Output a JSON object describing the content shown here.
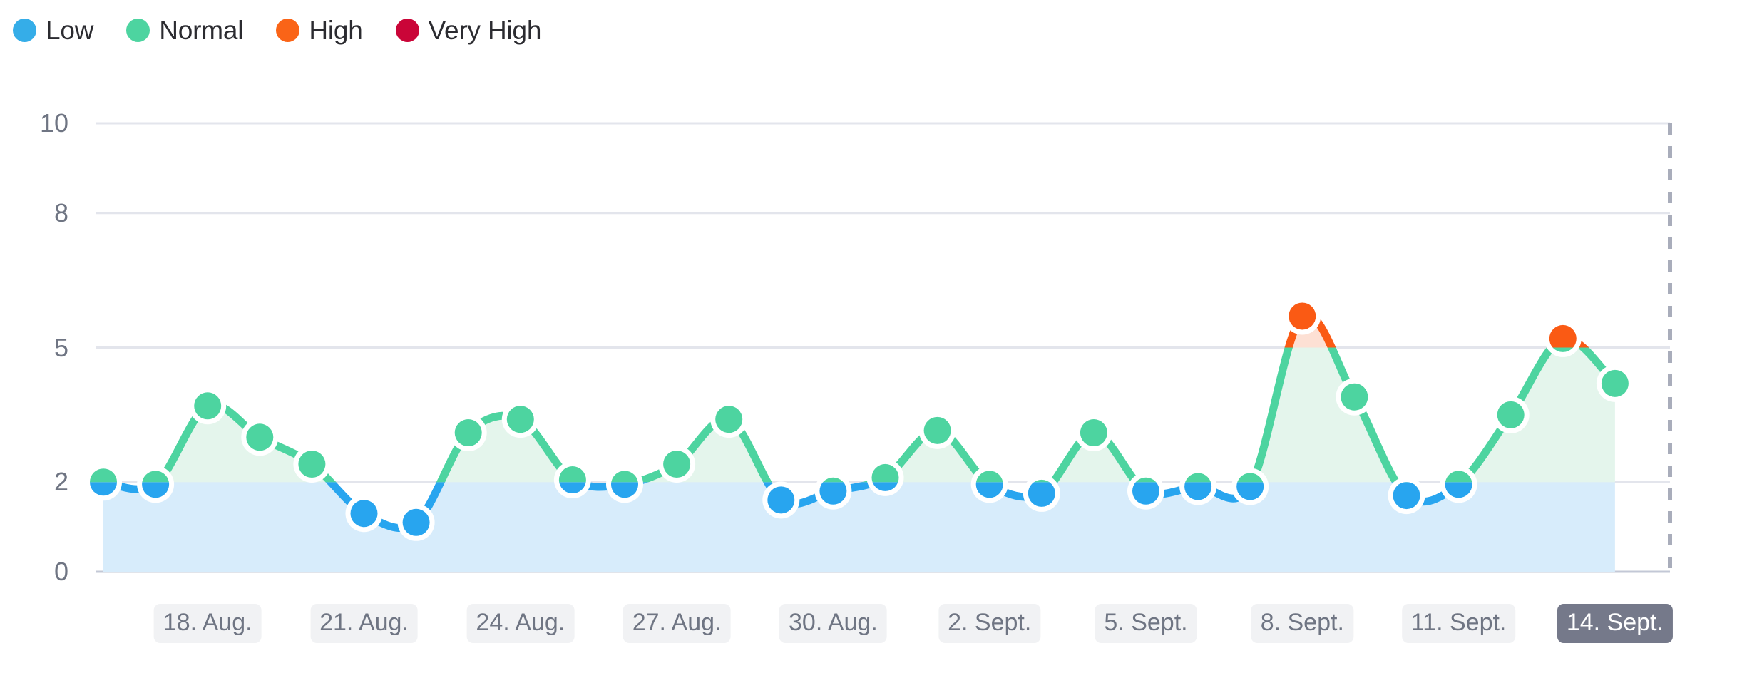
{
  "legend": {
    "items": [
      {
        "label": "Low",
        "color": "#35ade8",
        "icon": "legend-dot-icon"
      },
      {
        "label": "Normal",
        "color": "#4dd4a0",
        "icon": "legend-dot-icon"
      },
      {
        "label": "High",
        "color": "#fa6417",
        "icon": "legend-dot-icon"
      },
      {
        "label": "Very High",
        "color": "#ca0538",
        "icon": "legend-dot-icon"
      }
    ]
  },
  "chart_data": {
    "type": "line",
    "title": "",
    "subtitle": "",
    "xlabel": "",
    "ylabel": "",
    "ylim": [
      0,
      10
    ],
    "y_ticks": [
      10,
      8,
      5,
      2,
      0
    ],
    "grid": true,
    "legend_position": "top-left",
    "thresholds": {
      "low_max": 2,
      "normal_max": 5,
      "high_max": 8
    },
    "band_colors": {
      "low_fill": "#d7ecfb",
      "normal_fill": "#e4f5ec",
      "high_fill": "#fde0d4",
      "very_high_fill": "#f7d2dc",
      "low_line": "#28a5ef",
      "normal_line": "#4dd4a0",
      "high_line": "#fa5a14",
      "very_high_line": "#ca0538"
    },
    "today_marker": {
      "label": "14. Sept.",
      "style": "dashed-vertical-line",
      "color": "#a9adbb"
    },
    "x_tick_labels": [
      "18. Aug.",
      "21. Aug.",
      "24. Aug.",
      "27. Aug.",
      "30. Aug.",
      "2. Sept.",
      "5. Sept.",
      "8. Sept.",
      "11. Sept.",
      "14. Sept."
    ],
    "x_tick_indices": [
      2,
      5,
      8,
      11,
      14,
      17,
      20,
      23,
      26,
      29
    ],
    "x": [
      "16. Aug.",
      "17. Aug.",
      "18. Aug.",
      "19. Aug.",
      "20. Aug.",
      "21. Aug.",
      "22. Aug.",
      "23. Aug.",
      "24. Aug.",
      "25. Aug.",
      "26. Aug.",
      "27. Aug.",
      "28. Aug.",
      "29. Aug.",
      "30. Aug.",
      "31. Aug.",
      "1. Sept.",
      "2. Sept.",
      "3. Sept.",
      "4. Sept.",
      "5. Sept.",
      "6. Sept.",
      "7. Sept.",
      "8. Sept.",
      "9. Sept.",
      "10. Sept.",
      "11. Sept.",
      "12. Sept.",
      "13. Sept.",
      "14. Sept."
    ],
    "values": [
      2.0,
      1.95,
      3.7,
      3.0,
      2.4,
      1.3,
      1.1,
      3.1,
      3.4,
      2.05,
      1.95,
      2.4,
      3.4,
      1.6,
      1.8,
      2.1,
      3.15,
      1.95,
      1.75,
      3.1,
      1.8,
      1.9,
      1.9,
      5.7,
      3.9,
      1.7,
      1.95,
      3.5,
      5.2,
      4.2
    ],
    "point_categories": [
      "Normal",
      "Low",
      "Normal",
      "Normal",
      "Normal",
      "Low",
      "Low",
      "Normal",
      "Normal",
      "Normal",
      "Low",
      "Normal",
      "Normal",
      "Low",
      "Low",
      "Normal",
      "Normal",
      "Low",
      "Low",
      "Normal",
      "Low",
      "Low",
      "Low",
      "High",
      "Normal",
      "Low",
      "Low",
      "Normal",
      "High",
      "Normal"
    ]
  }
}
